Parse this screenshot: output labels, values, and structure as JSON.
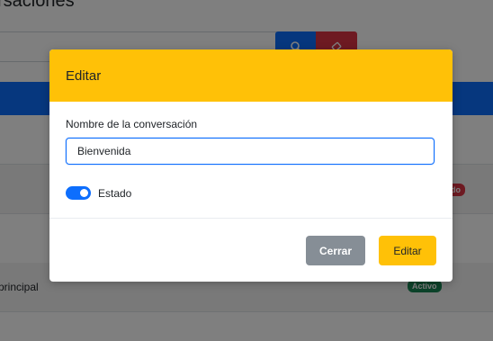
{
  "background": {
    "page_title": "rsaciones",
    "rows": [
      {
        "text": ""
      },
      {
        "text": ""
      },
      {
        "text": ""
      },
      {
        "text": "principal"
      }
    ],
    "badges": {
      "inactive": "do",
      "active": "Activo"
    }
  },
  "modal": {
    "title": "Editar",
    "field_label": "Nombre de la conversación",
    "field_value": "Bienvenida",
    "toggle_label": "Estado",
    "toggle_on": true,
    "close_label": "Cerrar",
    "save_label": "Editar"
  },
  "colors": {
    "header_accent": "#ffc107",
    "primary": "#0d6efd",
    "danger": "#dc3545",
    "success": "#198754",
    "secondary": "#868e96"
  }
}
